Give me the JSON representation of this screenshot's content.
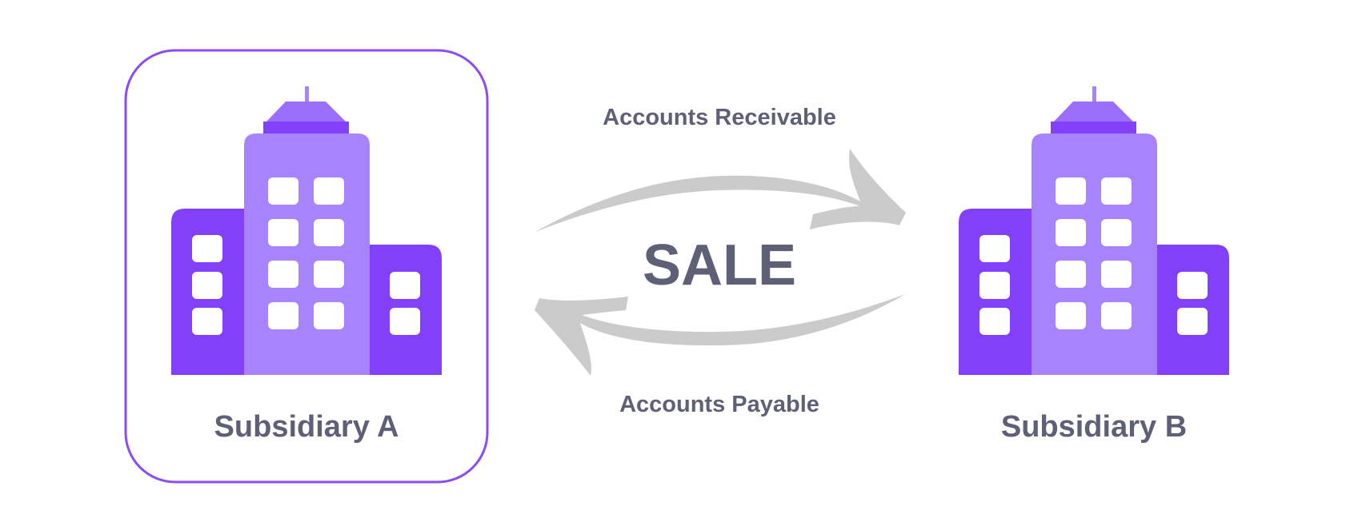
{
  "colors": {
    "text": "#5f6078",
    "building_dark": "#8340fb",
    "building_light": "#a784fd",
    "roof_light": "#9a6ffc",
    "frame_border": "#8b4cf7",
    "arrow": "#cbcbcb",
    "window": "#ffffff"
  },
  "subsidiary_a": {
    "label": "Subsidiary A",
    "highlighted": true
  },
  "subsidiary_b": {
    "label": "Subsidiary B",
    "highlighted": false
  },
  "flow": {
    "top_label": "Accounts Receivable",
    "center_label": "SALE",
    "bottom_label": "Accounts Payable"
  }
}
